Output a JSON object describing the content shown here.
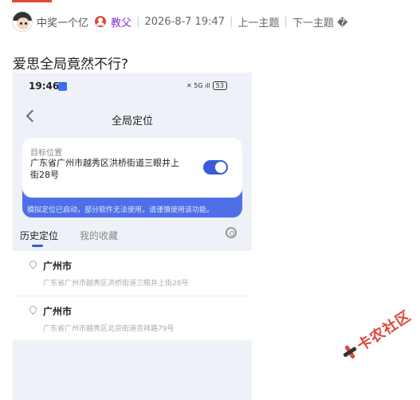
{
  "post": {
    "author": "中奖一个亿",
    "role": "教父",
    "datetime": "2026-8-7 19:47",
    "sep": "|",
    "prev_topic": "上一主题",
    "next_topic": "下一主题 �",
    "title": "爱思全局竟然不行?"
  },
  "phone": {
    "status_time": "19:46",
    "status_app_icon": "app-badge",
    "status_indicators": "✕ 5G ıll",
    "battery": "53",
    "nav_title": "全局定位",
    "target_label": "目标位置",
    "target_address": "广东省广州市越秀区洪桥街道三眼井上街28号",
    "toggle_on": true,
    "notice": "模拟定位已启动，部分软件无法使用，请谨慎使用该功能。",
    "tabs": [
      {
        "label": "历史定位",
        "active": true
      },
      {
        "label": "我的收藏",
        "active": false
      }
    ],
    "history": [
      {
        "city": "广州市",
        "address": "广东省广州市越秀区洪桥街道三眼井上街28号"
      },
      {
        "city": "广州市",
        "address": "广东省广州市越秀区北京街道吉祥路79号"
      }
    ]
  },
  "watermark": {
    "text": "卡农社区"
  },
  "colors": {
    "accent": "#e0463a",
    "role": "#8a2be2",
    "toggle": "#3a5bd9",
    "card_blue": "#4f6fe8"
  }
}
